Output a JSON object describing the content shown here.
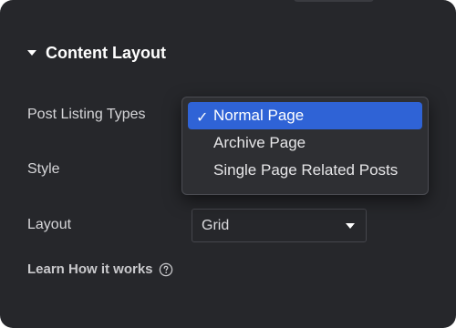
{
  "section": {
    "title": "Content Layout"
  },
  "fields": {
    "post_listing_types_label": "Post Listing Types",
    "style_label": "Style",
    "layout_label": "Layout",
    "layout_value": "Grid"
  },
  "dropdown": {
    "options": [
      {
        "label": "Normal Page",
        "selected": true
      },
      {
        "label": "Archive Page",
        "selected": false
      },
      {
        "label": "Single Page Related Posts",
        "selected": false
      }
    ],
    "check_glyph": "✓"
  },
  "learn": {
    "text": "Learn How it works"
  },
  "colors": {
    "panel_bg": "#26272b",
    "selected_option": "#2f63d6",
    "text": "#d6d6d9"
  }
}
